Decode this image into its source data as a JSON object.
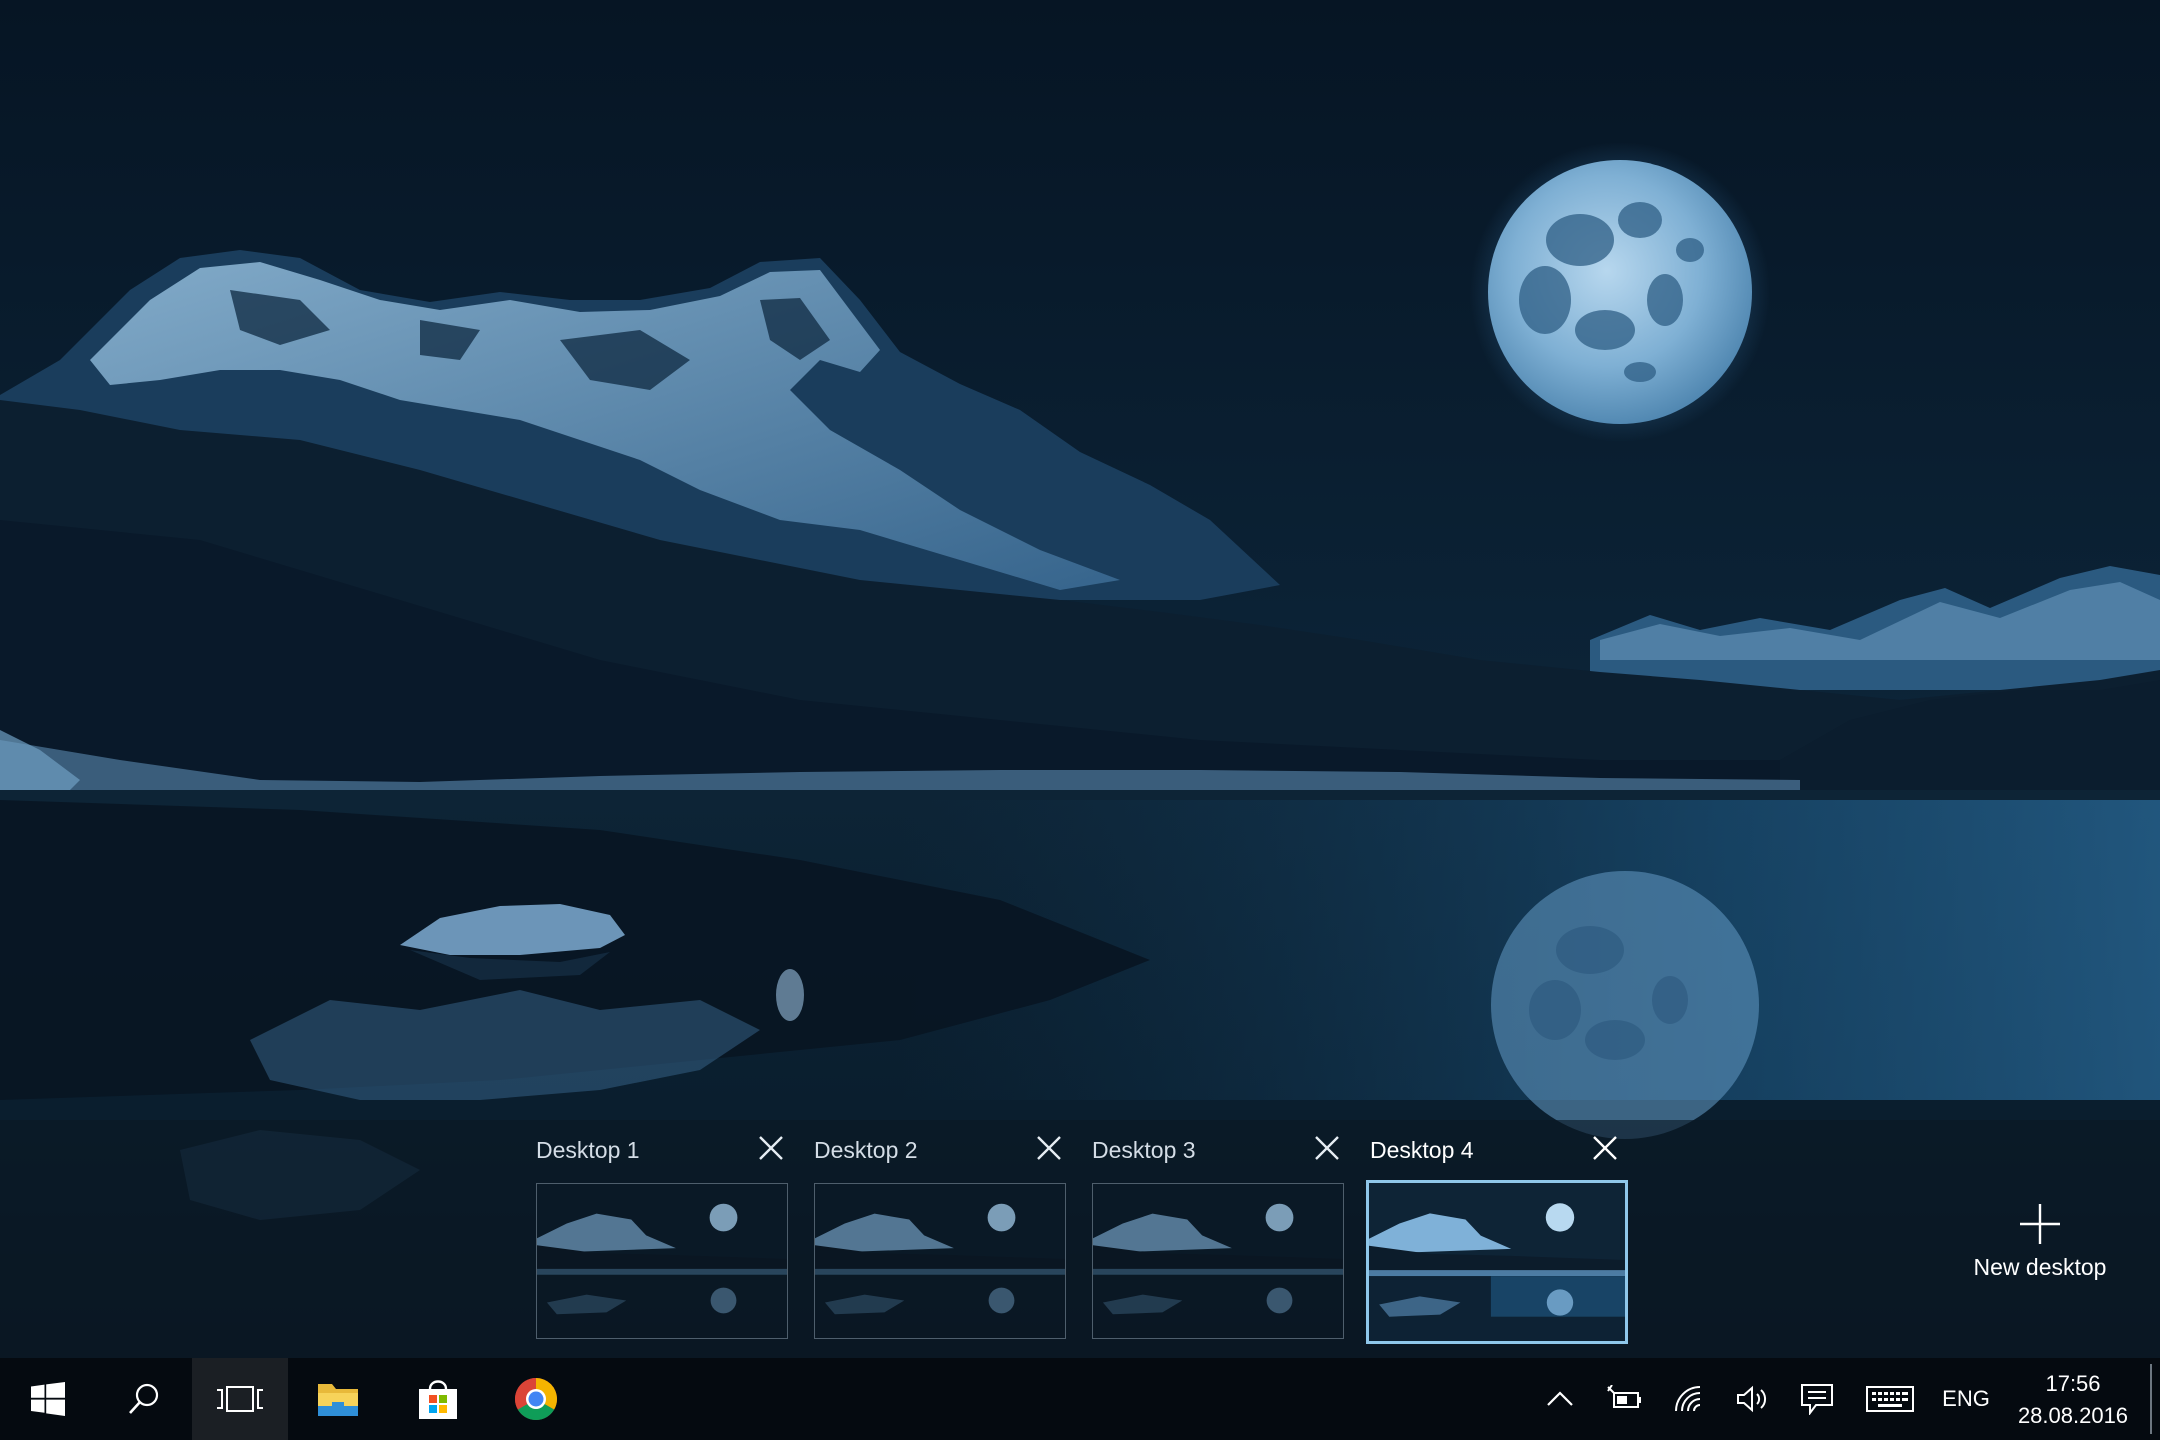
{
  "task_view": {
    "desktops": [
      {
        "label": "Desktop 1",
        "active": false
      },
      {
        "label": "Desktop 2",
        "active": false
      },
      {
        "label": "Desktop 3",
        "active": false
      },
      {
        "label": "Desktop 4",
        "active": true
      }
    ],
    "new_desktop_label": "New desktop"
  },
  "taskbar": {
    "pinned_icons": [
      "start-windows-icon",
      "search-icon",
      "task-view-icon",
      "file-explorer-icon",
      "store-icon",
      "chrome-icon"
    ],
    "tray_icons": [
      "show-hidden-icons-chevron-icon",
      "battery-power-icon",
      "wifi-network-icon",
      "volume-icon",
      "action-center-icon",
      "touch-keyboard-icon"
    ],
    "language": "ENG",
    "time": "17:56",
    "date": "28.08.2016"
  },
  "colors": {
    "accent": "#8fc7ea",
    "taskbar_bg": "#050a10",
    "sky": "#0a1e30"
  }
}
